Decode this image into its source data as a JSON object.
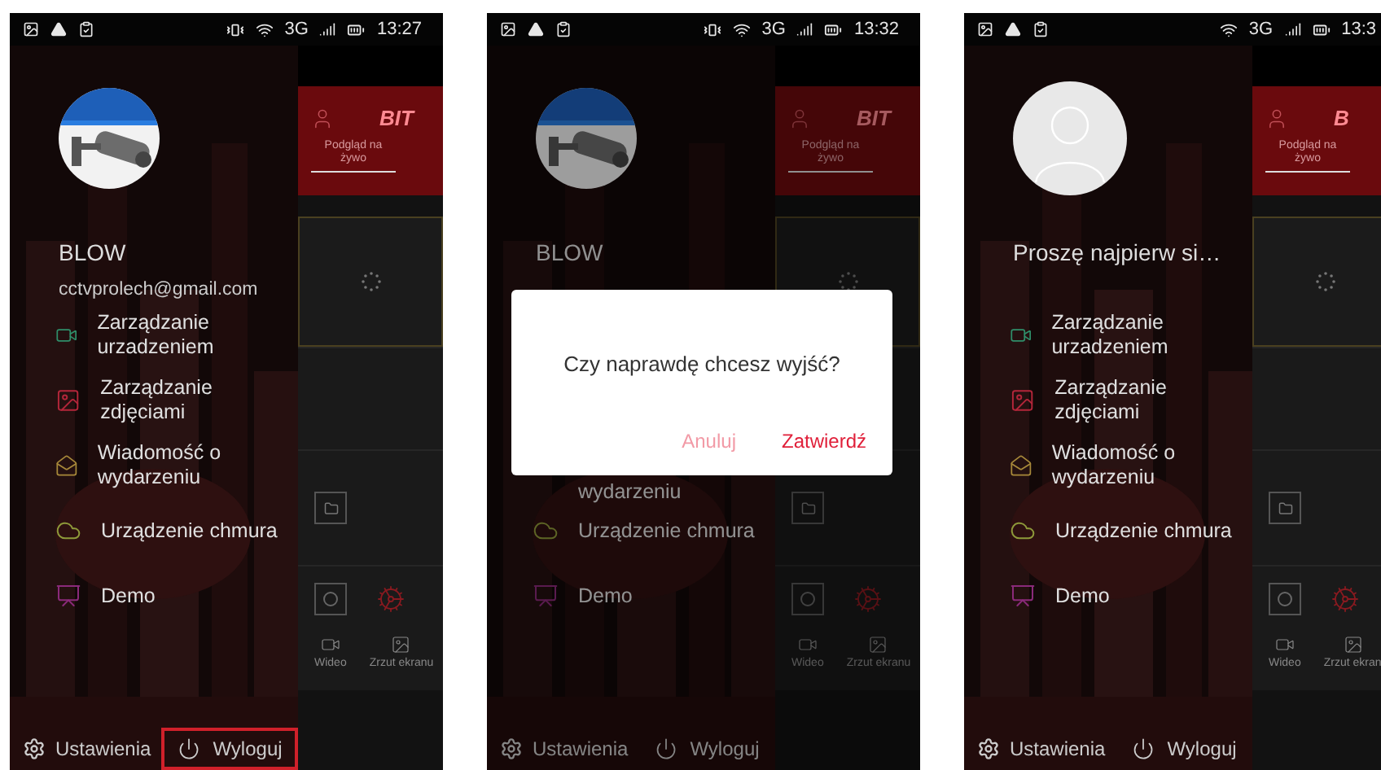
{
  "phones": [
    {
      "status_bar": {
        "vibrate": true,
        "network": "3G",
        "time": "13:27"
      },
      "drawer": {
        "name": "BLOW",
        "email": "cctvprolech@gmail.com",
        "menu": [
          {
            "label": "Zarządzanie urzadzeniem",
            "kind": "device"
          },
          {
            "label": "Zarządzanie zdjęciami",
            "kind": "photos"
          },
          {
            "label": "Wiadomość o wydarzeniu",
            "kind": "message"
          },
          {
            "label": "Urządzenie chmura",
            "kind": "cloud"
          },
          {
            "label": "Demo",
            "kind": "demo"
          }
        ],
        "footer": {
          "settings": "Ustawienia",
          "logout": "Wyloguj",
          "logout_highlighted": true
        }
      },
      "app": {
        "brand": "BIT",
        "tab": "Podgląd na żywo",
        "video_label": "Wideo",
        "capture_label": "Zrzut ekranu"
      }
    },
    {
      "status_bar": {
        "vibrate": true,
        "network": "3G",
        "time": "13:32"
      },
      "drawer": {
        "name": "BLOW",
        "menu": [
          {
            "label": "wydarzeniu",
            "kind": "partial"
          },
          {
            "label": "Urządzenie chmura",
            "kind": "cloud"
          },
          {
            "label": "Demo",
            "kind": "demo"
          }
        ],
        "footer": {
          "settings": "Ustawienia",
          "logout": "Wyloguj",
          "logout_highlighted": false
        }
      },
      "app": {
        "brand": "BIT",
        "tab": "Podgląd na żywo",
        "video_label": "Wideo",
        "capture_label": "Zrzut ekranu"
      },
      "dialog": {
        "message": "Czy naprawdę chcesz wyjść?",
        "cancel": "Anuluj",
        "confirm": "Zatwierdź"
      }
    },
    {
      "status_bar": {
        "vibrate": false,
        "network": "3G",
        "time": "13:3"
      },
      "drawer": {
        "avatar": {
          "kind": "placeholder"
        },
        "name": "Proszę najpierw si…",
        "menu": [
          {
            "label": "Zarządzanie urzadzeniem",
            "kind": "device"
          },
          {
            "label": "Zarządzanie zdjęciami",
            "kind": "photos"
          },
          {
            "label": "Wiadomość o wydarzeniu",
            "kind": "message"
          },
          {
            "label": "Urządzenie chmura",
            "kind": "cloud"
          },
          {
            "label": "Demo",
            "kind": "demo"
          }
        ],
        "footer": {
          "settings": "Ustawienia",
          "logout": "Wyloguj",
          "logout_highlighted": false
        }
      },
      "app": {
        "brand": "B",
        "tab": "Podgląd na żywo",
        "video_label": "Wideo",
        "capture_label": "Zrzut ekran"
      }
    }
  ]
}
